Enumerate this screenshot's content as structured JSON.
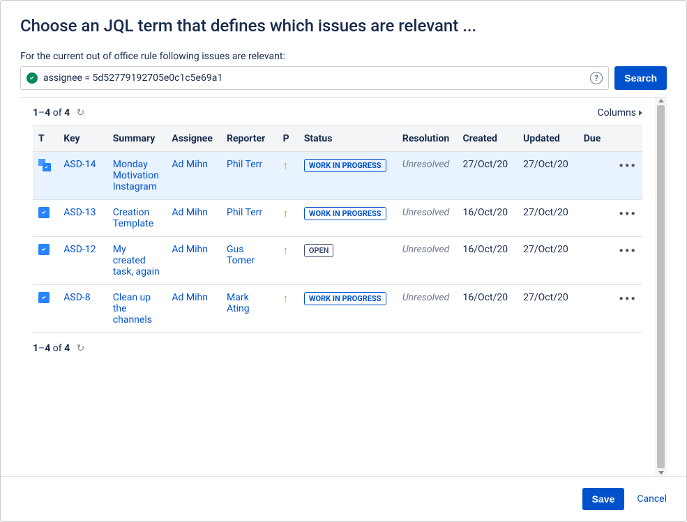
{
  "title": "Choose an JQL term that defines which issues are relevant ...",
  "subtitle": "For the current out of office rule following issues are relevant:",
  "jql": {
    "value": "assignee = 5d52779192705e0c1c5e69a1",
    "valid": true
  },
  "search_label": "Search",
  "pagination": {
    "start": "1",
    "end": "4",
    "of_label": "of",
    "total": "4"
  },
  "columns_label": "Columns",
  "table": {
    "headers": {
      "type": "T",
      "key": "Key",
      "summary": "Summary",
      "assignee": "Assignee",
      "reporter": "Reporter",
      "priority": "P",
      "status": "Status",
      "resolution": "Resolution",
      "created": "Created",
      "updated": "Updated",
      "due": "Due"
    },
    "rows": [
      {
        "type": "subtask",
        "key": "ASD-14",
        "summary": "Monday Motivation Instagram",
        "assignee": "Ad Mihn",
        "reporter": "Phil Terr",
        "priority": "medium",
        "status": "WORK IN PROGRESS",
        "status_class": "wip",
        "resolution": "Unresolved",
        "created": "27/Oct/20",
        "updated": "27/Oct/20",
        "due": "",
        "highlight": true
      },
      {
        "type": "task",
        "key": "ASD-13",
        "summary": "Creation Template",
        "assignee": "Ad Mihn",
        "reporter": "Phil Terr",
        "priority": "medium",
        "status": "WORK IN PROGRESS",
        "status_class": "wip",
        "resolution": "Unresolved",
        "created": "16/Oct/20",
        "updated": "27/Oct/20",
        "due": "",
        "highlight": false
      },
      {
        "type": "task",
        "key": "ASD-12",
        "summary": "My created task, again",
        "assignee": "Ad Mihn",
        "reporter": "Gus Tomer",
        "priority": "medium",
        "status": "OPEN",
        "status_class": "open",
        "resolution": "Unresolved",
        "created": "16/Oct/20",
        "updated": "27/Oct/20",
        "due": "",
        "highlight": false
      },
      {
        "type": "task",
        "key": "ASD-8",
        "summary": "Clean up the channels",
        "assignee": "Ad Mihn",
        "reporter": "Mark Ating",
        "priority": "medium",
        "status": "WORK IN PROGRESS",
        "status_class": "wip",
        "resolution": "Unresolved",
        "created": "16/Oct/20",
        "updated": "27/Oct/20",
        "due": "",
        "highlight": false
      }
    ]
  },
  "footer": {
    "save": "Save",
    "cancel": "Cancel"
  }
}
